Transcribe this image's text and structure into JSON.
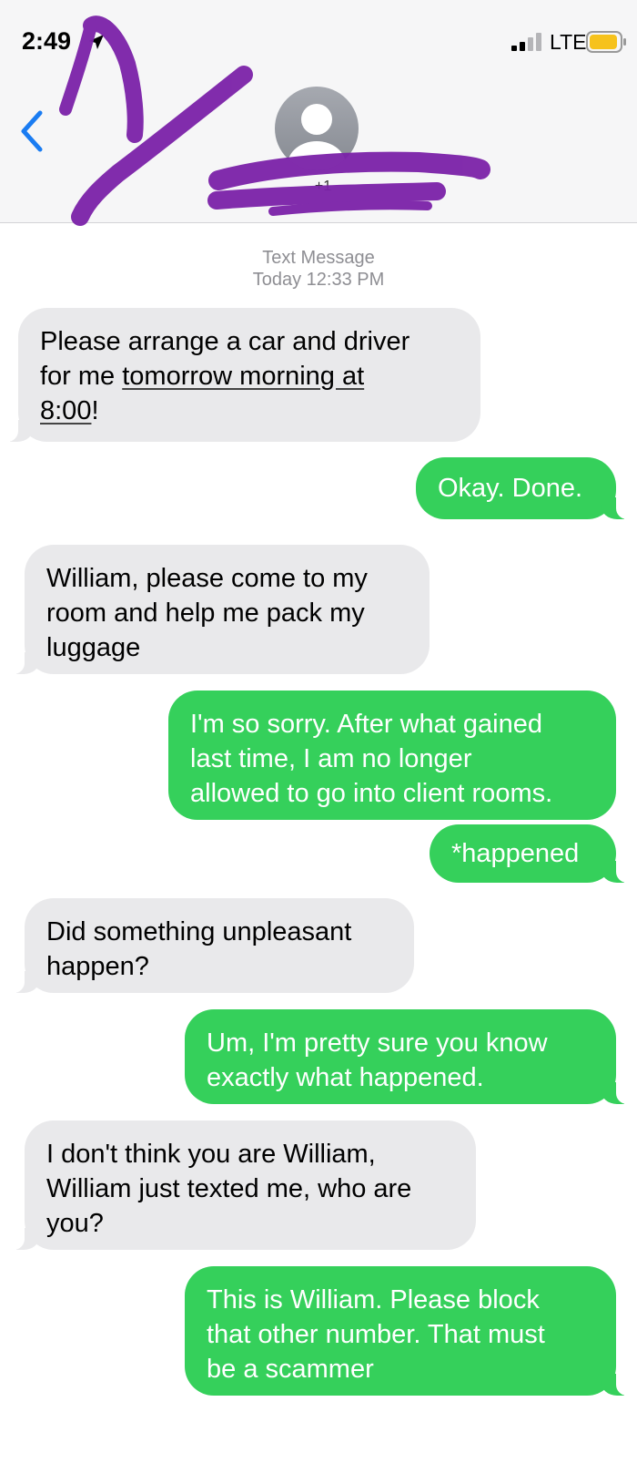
{
  "status_bar": {
    "time": "2:49",
    "carrier": "LTE"
  },
  "header": {
    "contact_name": "+1",
    "back_icon": "chevron-left-icon",
    "avatar_icon": "person-silhouette-icon",
    "redaction_color": "#7b22a8"
  },
  "thread": {
    "type_label": "Text Message",
    "date_label": "Today 12:33 PM"
  },
  "colors": {
    "incoming_bubble": "#e9e9eb",
    "outgoing_bubble": "#35d05b",
    "ios_blue": "#1a7cf2",
    "battery": "#f6c21c"
  },
  "messages": [
    {
      "from": "them",
      "lines": [
        "Please arrange a car and driver",
        "for me",
        "tomorrow morning at",
        "8:00",
        "!"
      ]
    },
    {
      "from": "me",
      "lines": [
        "Okay. Done."
      ]
    },
    {
      "from": "them",
      "lines": [
        "William, please come to my",
        "room and help me pack my",
        "luggage"
      ]
    },
    {
      "from": "me",
      "lines": [
        "I'm so sorry. After what gained",
        "last time, I am no longer",
        "allowed to go into client rooms."
      ]
    },
    {
      "from": "me",
      "lines": [
        "*happened"
      ]
    },
    {
      "from": "them",
      "lines": [
        "Did something unpleasant",
        "happen?"
      ]
    },
    {
      "from": "me",
      "lines": [
        "Um, I'm pretty sure you know",
        "exactly what happened."
      ]
    },
    {
      "from": "them",
      "lines": [
        "I don't think you are William,",
        "William just texted me, who are",
        "you?"
      ]
    },
    {
      "from": "me",
      "lines": [
        "This is William. Please block",
        "that other number. That must",
        "be a scammer"
      ]
    }
  ]
}
